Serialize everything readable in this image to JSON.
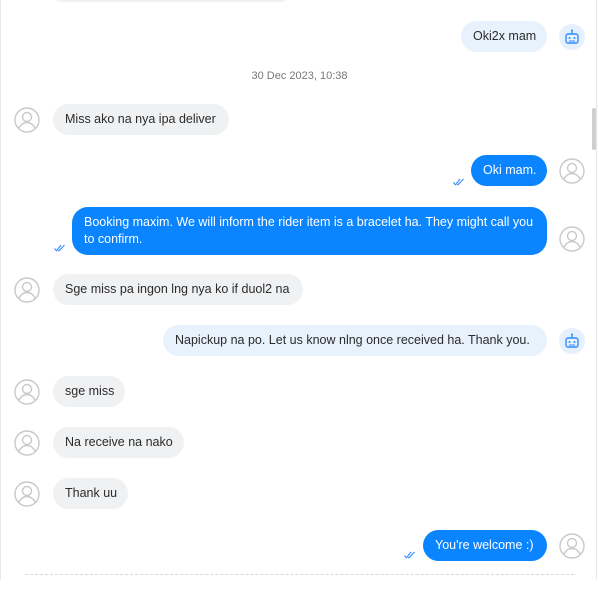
{
  "chat": {
    "messages": [
      {
        "side": "out",
        "style": "light",
        "text": "Oki2x mam",
        "sender": "bot"
      },
      {
        "side": "date",
        "text": "30 Dec 2023, 10:38"
      },
      {
        "side": "in",
        "text": "Miss ako na nya ipa deliver"
      },
      {
        "side": "out",
        "style": "blue",
        "text": "Oki mam.",
        "read": true,
        "sender": "agent"
      },
      {
        "side": "out",
        "style": "blue",
        "text": "Booking maxim. We will inform the rider item is a bracelet ha. They might call you to confirm.",
        "read": true,
        "sender": "agent"
      },
      {
        "side": "in",
        "text": "Sge miss pa ingon lng nya ko if duol2 na"
      },
      {
        "side": "out",
        "style": "light",
        "text": "Napickup na po. Let us know nlng once received ha. Thank you.",
        "sender": "bot"
      },
      {
        "side": "in",
        "text": "sge miss"
      },
      {
        "side": "in",
        "text": "Na receive na nako"
      },
      {
        "side": "in",
        "text": "Thank uu"
      },
      {
        "side": "out",
        "style": "blue",
        "text": "You're welcome :)",
        "read": true,
        "sender": "agent"
      }
    ]
  },
  "colors": {
    "accent": "#0a84ff",
    "incoming_bubble": "#f0f1f3",
    "outgoing_light_bubble": "#e8f2fd",
    "check": "#2f8bff"
  },
  "icons": {
    "avatar": "user-avatar-icon",
    "bot": "bot-icon",
    "read": "double-check-icon"
  }
}
